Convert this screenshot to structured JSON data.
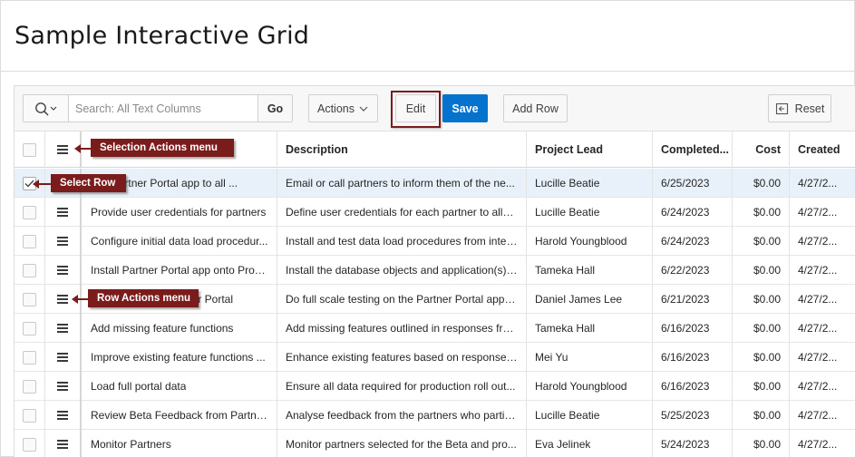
{
  "page": {
    "title": "Sample Interactive Grid"
  },
  "toolbar": {
    "search_placeholder": "Search: All Text Columns",
    "go_label": "Go",
    "actions_label": "Actions",
    "edit_label": "Edit",
    "save_label": "Save",
    "add_row_label": "Add Row",
    "reset_label": "Reset"
  },
  "grid": {
    "columns": [
      "Description",
      "Project Lead",
      "Completed...",
      "Cost",
      "Created"
    ],
    "rows": [
      {
        "name": "nce Partner Portal app to all ...",
        "description": "Email or call partners to inform them of the ne...",
        "lead": "Lucille Beatie",
        "completed": "6/25/2023",
        "cost": "$0.00",
        "created": "4/27/2..."
      },
      {
        "name": "Provide user credentials for partners",
        "description": "Define user credentials for each partner to allo...",
        "lead": "Lucille Beatie",
        "completed": "6/24/2023",
        "cost": "$0.00",
        "created": "4/27/2..."
      },
      {
        "name": "Configure initial data load procedur...",
        "description": "Install and test data load procedures from inter...",
        "lead": "Harold Youngblood",
        "completed": "6/24/2023",
        "cost": "$0.00",
        "created": "4/27/2..."
      },
      {
        "name": "Install Partner Portal app onto Prod...",
        "description": "Install the database objects and application(s) i...",
        "lead": "Tameka Hall",
        "completed": "6/22/2023",
        "cost": "$0.00",
        "created": "4/27/2..."
      },
      {
        "name": "r Portal",
        "description": "Do full scale testing on the Partner Portal appli...",
        "lead": "Daniel James Lee",
        "completed": "6/21/2023",
        "cost": "$0.00",
        "created": "4/27/2..."
      },
      {
        "name": "Add missing feature functions",
        "description": "Add missing features outlined in responses fro...",
        "lead": "Tameka Hall",
        "completed": "6/16/2023",
        "cost": "$0.00",
        "created": "4/27/2..."
      },
      {
        "name": "Improve existing feature functions ...",
        "description": "Enhance existing features based on responses ...",
        "lead": "Mei Yu",
        "completed": "6/16/2023",
        "cost": "$0.00",
        "created": "4/27/2..."
      },
      {
        "name": "Load full portal data",
        "description": "Ensure all data required for production roll out...",
        "lead": "Harold Youngblood",
        "completed": "6/16/2023",
        "cost": "$0.00",
        "created": "4/27/2..."
      },
      {
        "name": "Review Beta Feedback from Partners",
        "description": "Analyse feedback from the partners who partic...",
        "lead": "Lucille Beatie",
        "completed": "5/25/2023",
        "cost": "$0.00",
        "created": "4/27/2..."
      },
      {
        "name": "Monitor Partners",
        "description": "Monitor partners selected for the Beta and pro...",
        "lead": "Eva Jelinek",
        "completed": "5/24/2023",
        "cost": "$0.00",
        "created": "4/27/2..."
      }
    ]
  },
  "callouts": {
    "selection_actions": "Selection Actions menu",
    "select_row": "Select Row",
    "row_actions": "Row Actions menu"
  },
  "colors": {
    "accent": "#0572ce",
    "callout": "#7a1c1c",
    "selected_row": "#e8f1fa"
  },
  "icons": [
    "search-icon",
    "chevron-down-icon",
    "hamburger-icon",
    "reset-icon",
    "checkmark-icon"
  ]
}
